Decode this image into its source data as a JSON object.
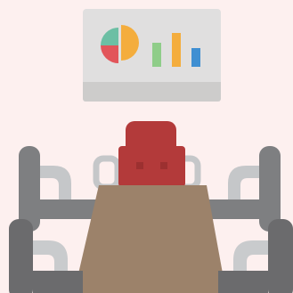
{
  "scene": {
    "name": "meeting-room-illustration"
  },
  "colors": {
    "background": "#fdf0ef",
    "board": "#e0dfdf",
    "board_ledge": "#cdcccb",
    "pie_teal": "#6cbfa4",
    "pie_red": "#e2555a",
    "pie_orange": "#f4ad3d",
    "bar_green": "#8fcd89",
    "bar_orange": "#f4ad3d",
    "bar_blue": "#3f8fd2",
    "chair_dark": "#6b6b6d",
    "chair_mid": "#7e7f81",
    "armrest": "#c5c7c9",
    "seat_light": "#c9cbcd",
    "head_chair": "#b33a3a",
    "head_chair_dark": "#9c3030",
    "table": "#9c826a",
    "table_edge": "#8a735d"
  },
  "board_chart": {
    "type": "pie-and-bar icon",
    "pie_slices": [
      0.5,
      0.25,
      0.25
    ],
    "bar_levels": [
      0.6,
      1.0,
      0.55
    ]
  }
}
